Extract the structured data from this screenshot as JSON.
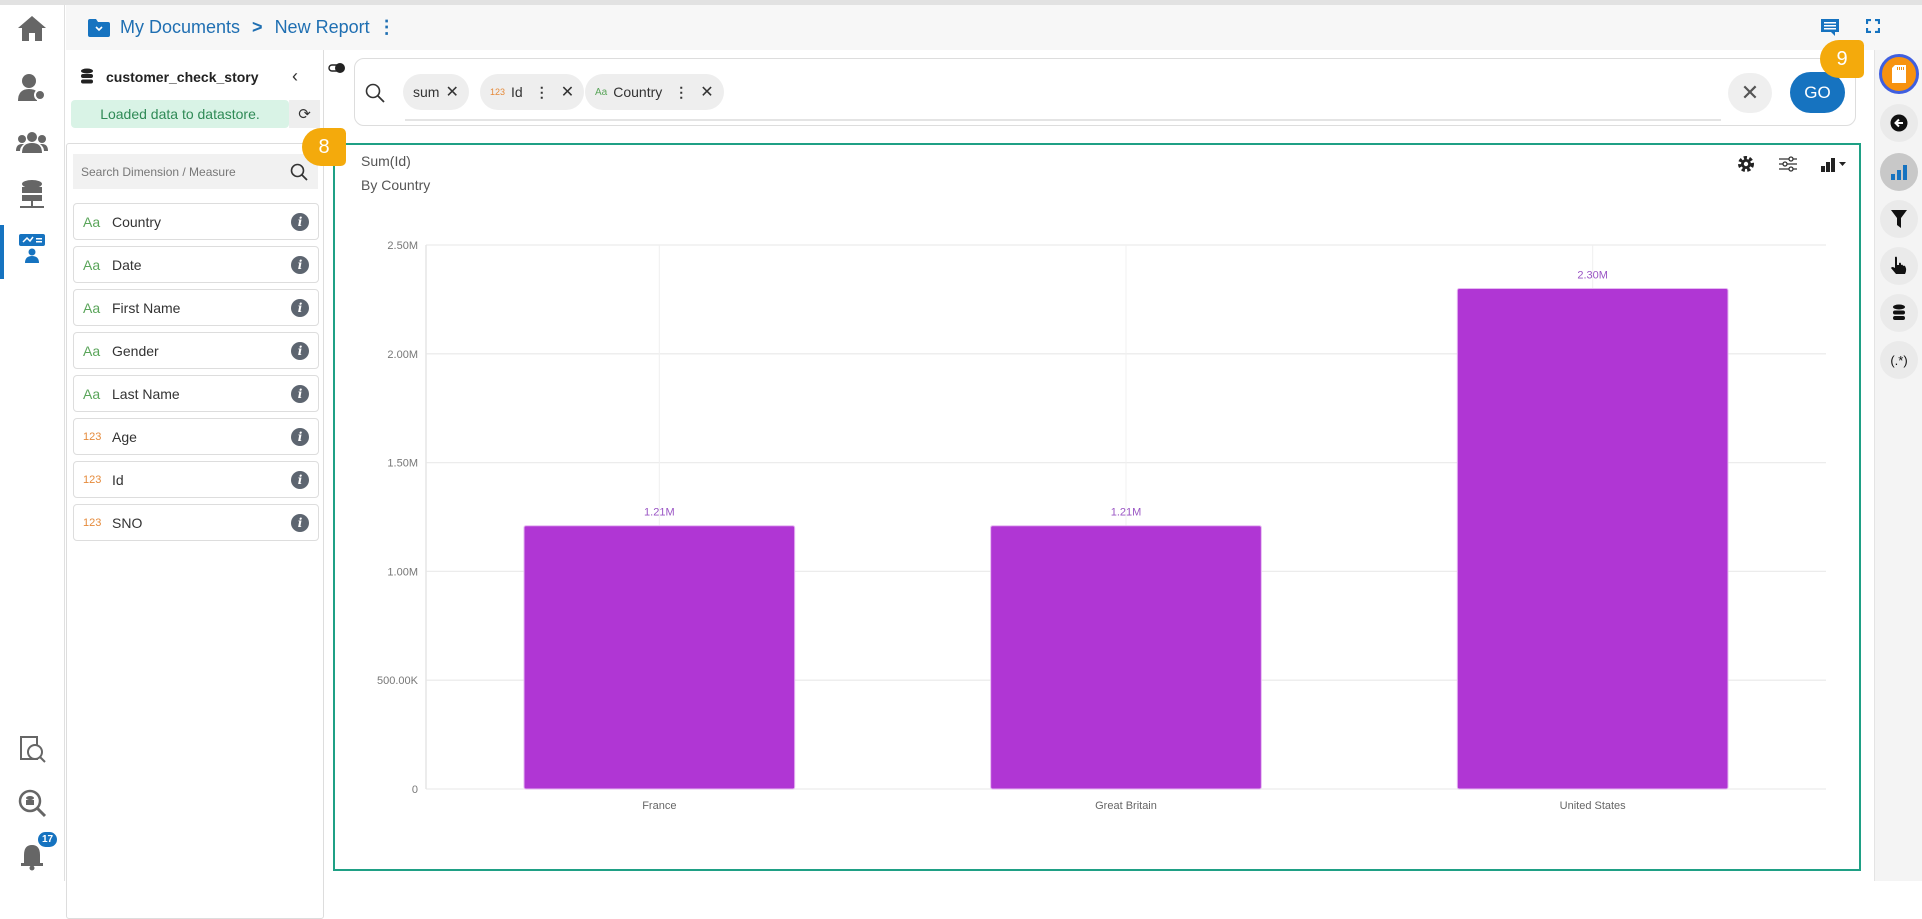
{
  "breadcrumb": {
    "root": "My Documents",
    "current": "New Report"
  },
  "panel": {
    "dataset": "customer_check_story",
    "status": "Loaded data to datastore.",
    "search_placeholder": "Search Dimension / Measure",
    "fields": [
      {
        "type": "Aa",
        "kind": "dim",
        "name": "Country"
      },
      {
        "type": "Aa",
        "kind": "dim",
        "name": "Date"
      },
      {
        "type": "Aa",
        "kind": "dim",
        "name": "First Name"
      },
      {
        "type": "Aa",
        "kind": "dim",
        "name": "Gender"
      },
      {
        "type": "Aa",
        "kind": "dim",
        "name": "Last Name"
      },
      {
        "type": "123",
        "kind": "mea",
        "name": "Age"
      },
      {
        "type": "123",
        "kind": "mea",
        "name": "Id"
      },
      {
        "type": "123",
        "kind": "mea",
        "name": "SNO"
      }
    ]
  },
  "query": {
    "chips": [
      {
        "label": "sum"
      },
      {
        "type": "123",
        "label": "Id"
      },
      {
        "type": "Aa",
        "label": "Country"
      }
    ],
    "go": "GO"
  },
  "notifications": {
    "count": "17"
  },
  "callouts": {
    "a": "8",
    "b": "9"
  },
  "colors": {
    "accent": "#1673c0",
    "bar": "#b036d4",
    "border": "#1fa085",
    "callout": "#f4aa0c"
  },
  "chart_data": {
    "type": "bar",
    "title": "Sum(Id)",
    "subtitle": "By Country",
    "categories": [
      "France",
      "Great Britain",
      "United States"
    ],
    "values": [
      1210000,
      1210000,
      2300000
    ],
    "labels": [
      "1.21M",
      "1.21M",
      "2.30M"
    ],
    "ylim": [
      0,
      2500000
    ],
    "yticks": [
      0,
      500000,
      1000000,
      1500000,
      2000000,
      2500000
    ],
    "ytick_labels": [
      "0",
      "500.00K",
      "1.00M",
      "1.50M",
      "2.00M",
      "2.50M"
    ],
    "grid": true
  }
}
